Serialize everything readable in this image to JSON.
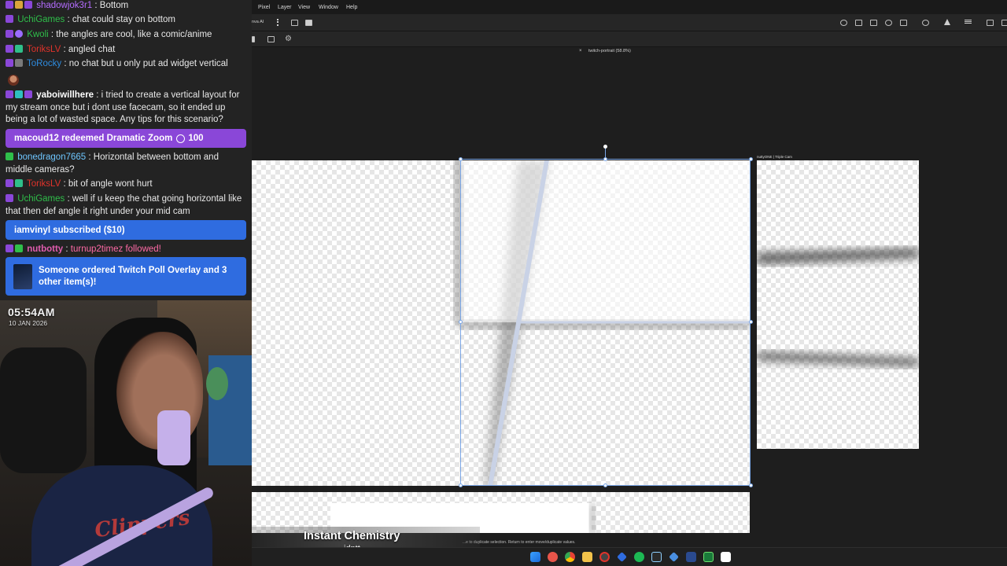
{
  "chat": {
    "messages": [
      {
        "user": "shadowjok3r1",
        "text": "Bottom",
        "color": "#b46cff"
      },
      {
        "user": "UchiGames",
        "text": "chat could stay on bottom",
        "color": "#2fbf4a"
      },
      {
        "user": "Kwoli",
        "text": "the angles are cool, like a comic/anime",
        "color": "#2fbf4a"
      },
      {
        "user": "ToriksLV",
        "text": "angled chat",
        "color": "#e0332b"
      },
      {
        "user": "ToRocky",
        "text": "no chat but u only put ad widget vertical",
        "color": "#2e8ce0"
      },
      {
        "user": "yaboiwillhere",
        "text": "i tried to create a vertical layout for my stream once but i dont use facecam, so it ended up being a lot of wasted space. Any tips for this scenario?",
        "color": "#ffffff"
      },
      {
        "user": "bonedragon7665",
        "text": "Horizontal between bottom and middle cameras?",
        "color": "#6ec6ff"
      },
      {
        "user": "ToriksLV",
        "text": "bit of angle wont hurt",
        "color": "#e0332b"
      },
      {
        "user": "UchiGames",
        "text": "well if u keep the chat going horizontal like that then def angle it right under your mid cam",
        "color": "#2fbf4a"
      },
      {
        "user": "nutbotty",
        "text": "turnup2timez followed!",
        "color": "#e05cae"
      }
    ],
    "separator": ":",
    "redeem_banner": {
      "text": "macoud12 redeemed Dramatic Zoom",
      "points": "100"
    },
    "sub_banner": "iamvinyl subscribed ($10)",
    "order_banner": "Someone ordered Twitch Poll Overlay and 3 other item(s)!"
  },
  "webcam": {
    "clock": "05:54AM",
    "date": "10 JAN 2026",
    "jersey": "Clippers"
  },
  "editor": {
    "menu": [
      "Pixel",
      "Layer",
      "View",
      "Window",
      "Help"
    ],
    "options_label": "nva AI",
    "tab_close": "×",
    "tab_title": "twitch-portrait (58.8%)",
    "artboard_label": "nuttyONE | Triple Cam",
    "status_hint": "...e to duplicate selection. Return to enter move/duplicate values."
  },
  "now_playing": {
    "title": "Instant Chemistry",
    "artist": "idntt"
  }
}
